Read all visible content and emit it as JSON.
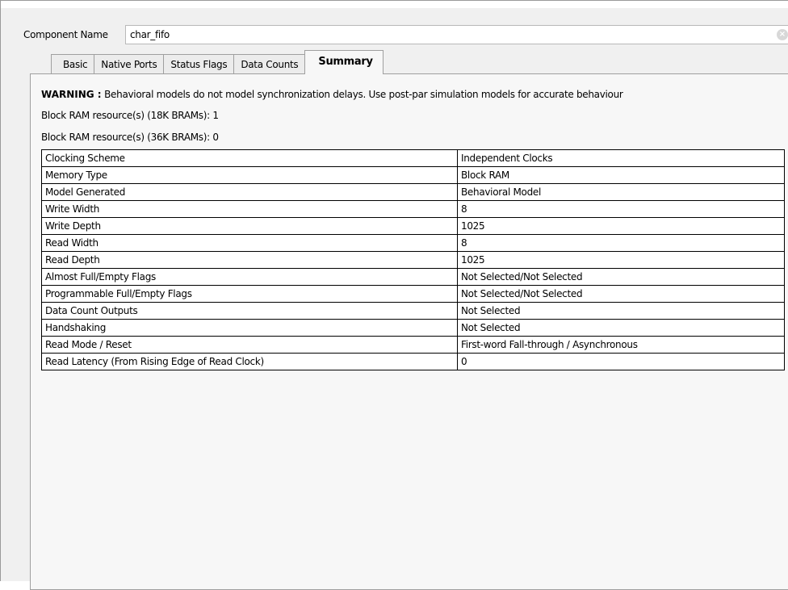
{
  "component": {
    "label": "Component Name",
    "value": "char_fifo"
  },
  "tabs": [
    {
      "label": "Basic"
    },
    {
      "label": "Native Ports"
    },
    {
      "label": "Status Flags"
    },
    {
      "label": "Data Counts"
    },
    {
      "label": "Summary"
    }
  ],
  "active_tab": "Summary",
  "summary": {
    "warning_prefix": "WARNING :",
    "warning_text": " Behavioral models do not model synchronization delays. Use post-par simulation models for accurate behaviour",
    "bram_18k": "Block RAM resource(s) (18K BRAMs): 1",
    "bram_36k": "Block RAM resource(s) (36K BRAMs): 0",
    "rows": [
      {
        "name": "Clocking Scheme",
        "value": "Independent Clocks"
      },
      {
        "name": "Memory Type",
        "value": "Block RAM"
      },
      {
        "name": "Model Generated",
        "value": "Behavioral Model"
      },
      {
        "name": "Write Width",
        "value": "8"
      },
      {
        "name": "Write Depth",
        "value": "1025"
      },
      {
        "name": "Read Width",
        "value": "8"
      },
      {
        "name": "Read Depth",
        "value": "1025"
      },
      {
        "name": "Almost Full/Empty Flags",
        "value": "Not Selected/Not Selected"
      },
      {
        "name": "Programmable Full/Empty Flags",
        "value": "Not Selected/Not Selected"
      },
      {
        "name": "Data Count Outputs",
        "value": "Not Selected"
      },
      {
        "name": "Handshaking",
        "value": "Not Selected"
      },
      {
        "name": "Read Mode / Reset",
        "value": "First-word Fall-through / Asynchronous"
      },
      {
        "name": "Read Latency (From Rising Edge of Read Clock)",
        "value": "0"
      }
    ]
  }
}
